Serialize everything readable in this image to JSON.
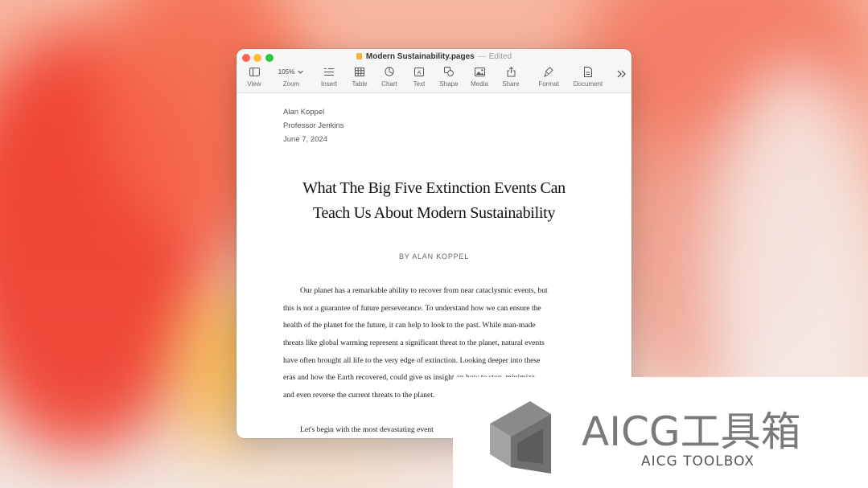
{
  "window": {
    "title": "Modern Sustainability.pages",
    "status": "Edited"
  },
  "toolbar": {
    "zoom_value": "105%",
    "items": [
      {
        "label": "View",
        "icon": "sidebar-view-icon"
      },
      {
        "label": "Zoom",
        "icon": "zoom-menu-icon"
      },
      {
        "label": "Insert",
        "icon": "insert-list-icon"
      },
      {
        "label": "Table",
        "icon": "table-icon"
      },
      {
        "label": "Chart",
        "icon": "chart-pie-icon"
      },
      {
        "label": "Text",
        "icon": "text-box-icon"
      },
      {
        "label": "Shape",
        "icon": "shape-icon"
      },
      {
        "label": "Media",
        "icon": "media-photo-icon"
      },
      {
        "label": "Share",
        "icon": "share-icon"
      },
      {
        "label": "Format",
        "icon": "format-brush-icon"
      },
      {
        "label": "Document",
        "icon": "document-icon"
      }
    ],
    "overflow_icon": "chevron-double-right-icon"
  },
  "document": {
    "author": "Alan Koppel",
    "professor": "Professor Jenkins",
    "date": "June 7, 2024",
    "headline_line1": "What The Big Five Extinction Events Can",
    "headline_line2": "Teach Us About Modern Sustainability",
    "byline": "BY ALAN KOPPEL",
    "paragraph1": [
      "Our planet has a remarkable ability to recover from near cataclysmic events, but",
      "this is not a guarantee of future perseverance. To understand how we can ensure the",
      "health of the planet for the future, it can help to look to the past. While man-made",
      "threats like global warming represent a significant threat to the planet, natural events",
      "have often brought all life to the very edge of extinction. Looking deeper into these",
      "eras and how the Earth recovered, could give us insight on how to stop, minimize,",
      "and even reverse the current threats to the planet."
    ],
    "paragraph2_start": "Let's begin with the most devastating event"
  },
  "watermark": {
    "main": "AICG工具箱",
    "sub": "AICG TOOLBOX"
  },
  "colors": {
    "close": "#fe5f57",
    "minimize": "#febc2e",
    "maximize": "#28c840",
    "wallpaper_red": "#ef3b2a",
    "wallpaper_yellow": "#f4b338"
  }
}
